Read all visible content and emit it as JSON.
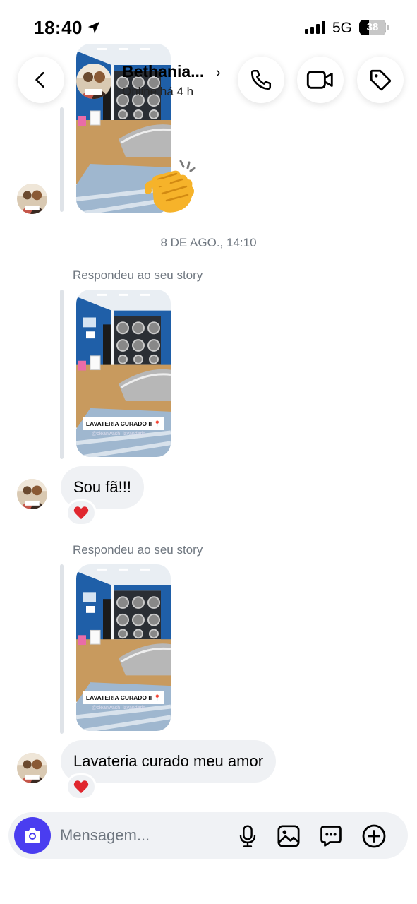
{
  "status_bar": {
    "time": "18:40",
    "network": "5G",
    "battery": "38",
    "battery_level": 0.38
  },
  "header": {
    "contact_name": "Bethania...",
    "chevron": "›",
    "status": "Online há 4 h",
    "buttons": {
      "back": "back-icon",
      "call": "phone-icon",
      "video": "video-camera-icon",
      "tag": "tag-icon"
    }
  },
  "conversation": {
    "timestamp": "8 DE AGO., 14:10",
    "clap_reaction": "👏",
    "messages": [
      {
        "replied_label": "Respondeu ao seu story",
        "story_caption": "LAVATERIA CURADO II 📍",
        "story_handle": "@cleanwash_lavanderia",
        "text": "Sou fã!!!",
        "reaction": "❤️"
      },
      {
        "replied_label": "Respondeu ao seu story",
        "story_caption": "LAVATERIA CURADO II 📍",
        "story_handle": "@cleanwash_lavanderia",
        "text": "Lavateria curado meu amor",
        "reaction": "❤️"
      }
    ]
  },
  "composer": {
    "placeholder": "Mensagem...",
    "icons": [
      "camera-icon",
      "microphone-icon",
      "gallery-icon",
      "sticker-icon",
      "add-icon"
    ]
  },
  "colors": {
    "accent": "#4a3df0",
    "bubble": "#eff1f4",
    "muted_text": "#6f7780",
    "reaction_heart": "#e0262e"
  }
}
